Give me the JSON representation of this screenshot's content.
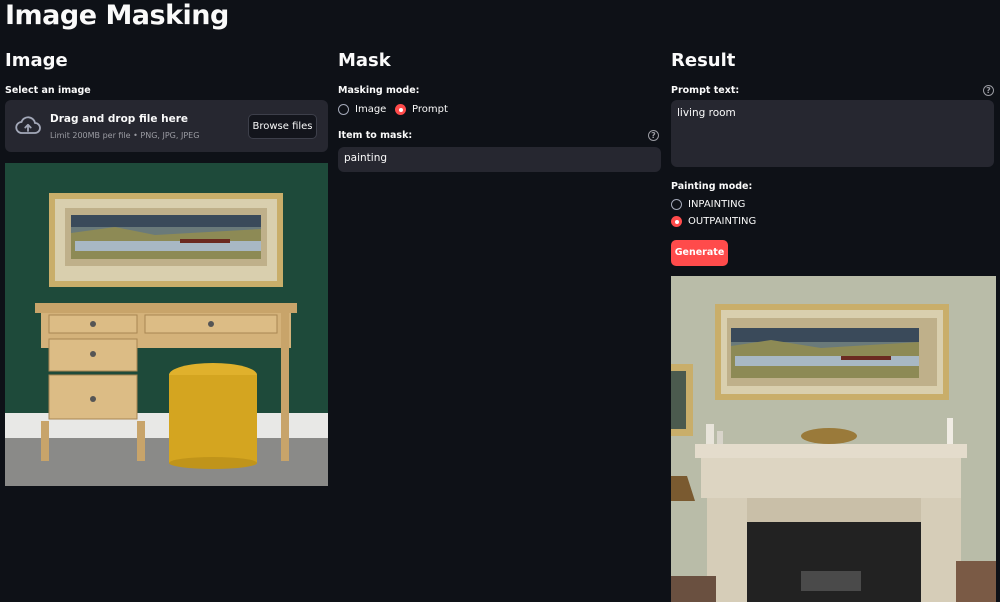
{
  "app": {
    "title": "Image Masking"
  },
  "image_col": {
    "heading": "Image",
    "select_label": "Select an image",
    "uploader": {
      "main_text": "Drag and drop file here",
      "sub_text": "Limit 200MB per file • PNG, JPG, JPEG",
      "browse_label": "Browse files",
      "icon": "cloud-upload-icon"
    },
    "preview_alt": "uploaded image preview: wooden desk with yellow stool below a framed landscape painting on green wall"
  },
  "mask_col": {
    "heading": "Mask",
    "mode_label": "Masking mode:",
    "mode_options": [
      "Image",
      "Prompt"
    ],
    "mode_selected": "Prompt",
    "item_label": "Item to mask:",
    "item_value": "painting"
  },
  "result_col": {
    "heading": "Result",
    "prompt_label": "Prompt text:",
    "prompt_value": "living room",
    "paint_label": "Painting mode:",
    "paint_options": [
      "INPAINTING",
      "OUTPAINTING"
    ],
    "paint_selected": "OUTPAINTING",
    "generate_label": "Generate"
  },
  "colors": {
    "background": "#0e1117",
    "widget": "#262730",
    "accent": "#ff4b4b",
    "text": "#fafafa",
    "muted": "#9a9ba2"
  }
}
